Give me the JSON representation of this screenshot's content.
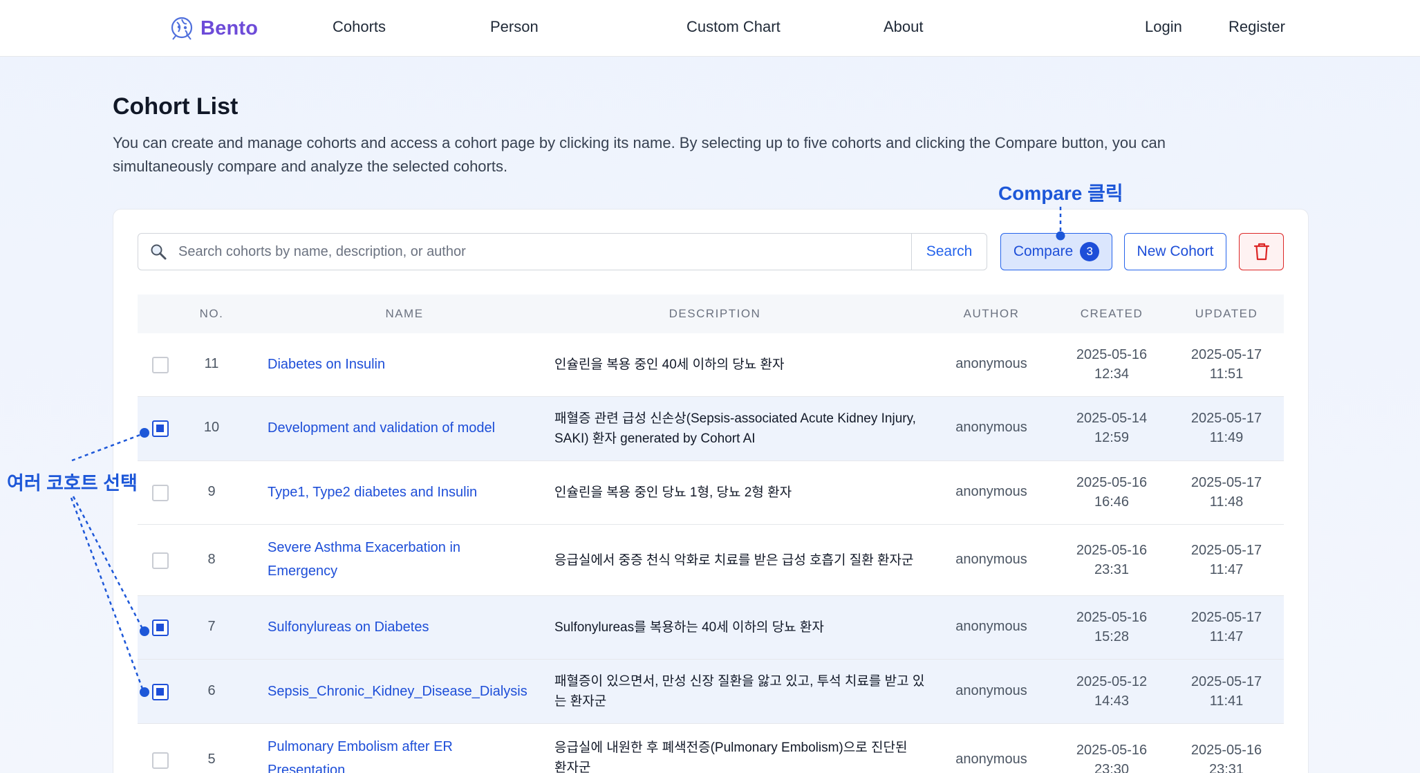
{
  "nav": {
    "brand": "Bento",
    "links": [
      "Cohorts",
      "Person",
      "Custom Chart",
      "About"
    ],
    "login": "Login",
    "register": "Register"
  },
  "header": {
    "title": "Cohort List",
    "description": "You can create and manage cohorts and access a cohort page by clicking its name. By selecting up to five cohorts and clicking the Compare button, you can simultaneously compare and analyze the selected cohorts."
  },
  "toolbar": {
    "search_placeholder": "Search cohorts by name, description, or author",
    "search_label": "Search",
    "compare_label": "Compare",
    "compare_count": "3",
    "new_cohort_label": "New Cohort"
  },
  "table": {
    "columns": [
      "NO.",
      "NAME",
      "DESCRIPTION",
      "AUTHOR",
      "CREATED",
      "UPDATED"
    ],
    "rows": [
      {
        "no": "11",
        "name": "Diabetes on Insulin",
        "description": "인슐린을 복용 중인 40세 이하의 당뇨 환자",
        "author": "anonymous",
        "created_date": "2025-05-16",
        "created_time": "12:34",
        "updated_date": "2025-05-17",
        "updated_time": "11:51",
        "selected": false
      },
      {
        "no": "10",
        "name": "Development and validation of model",
        "description": "패혈증 관련 급성 신손상(Sepsis-associated Acute Kidney Injury, SAKI) 환자 generated by Cohort AI",
        "author": "anonymous",
        "created_date": "2025-05-14",
        "created_time": "12:59",
        "updated_date": "2025-05-17",
        "updated_time": "11:49",
        "selected": true
      },
      {
        "no": "9",
        "name": "Type1, Type2 diabetes and Insulin",
        "description": "인슐린을 복용 중인 당뇨 1형, 당뇨 2형 환자",
        "author": "anonymous",
        "created_date": "2025-05-16",
        "created_time": "16:46",
        "updated_date": "2025-05-17",
        "updated_time": "11:48",
        "selected": false
      },
      {
        "no": "8",
        "name": "Severe Asthma Exacerbation in Emergency",
        "description": "응급실에서 중증 천식 악화로 치료를 받은 급성 호흡기 질환 환자군",
        "author": "anonymous",
        "created_date": "2025-05-16",
        "created_time": "23:31",
        "updated_date": "2025-05-17",
        "updated_time": "11:47",
        "selected": false
      },
      {
        "no": "7",
        "name": "Sulfonylureas on Diabetes",
        "description": "Sulfonylureas를 복용하는 40세 이하의 당뇨 환자",
        "author": "anonymous",
        "created_date": "2025-05-16",
        "created_time": "15:28",
        "updated_date": "2025-05-17",
        "updated_time": "11:47",
        "selected": true
      },
      {
        "no": "6",
        "name": "Sepsis_Chronic_Kidney_Disease_Dialysis",
        "description": "패혈증이 있으면서, 만성 신장 질환을 앓고 있고, 투석 치료를 받고 있는 환자군",
        "author": "anonymous",
        "created_date": "2025-05-12",
        "created_time": "14:43",
        "updated_date": "2025-05-17",
        "updated_time": "11:41",
        "selected": true
      },
      {
        "no": "5",
        "name": "Pulmonary Embolism after ER Presentation",
        "description": "응급실에 내원한 후 폐색전증(Pulmonary Embolism)으로 진단된 환자군",
        "author": "anonymous",
        "created_date": "2025-05-16",
        "created_time": "23:30",
        "updated_date": "2025-05-16",
        "updated_time": "23:31",
        "selected": false
      }
    ]
  },
  "annotations": {
    "compare_click": "Compare 클릭",
    "multi_select": "여러 코호트 선택"
  },
  "colors": {
    "brand": "#6d4bd8",
    "accent": "#1d4ed8",
    "annotation": "#1d57d8",
    "danger": "#dc2626",
    "selected_row": "#eef3fc"
  }
}
